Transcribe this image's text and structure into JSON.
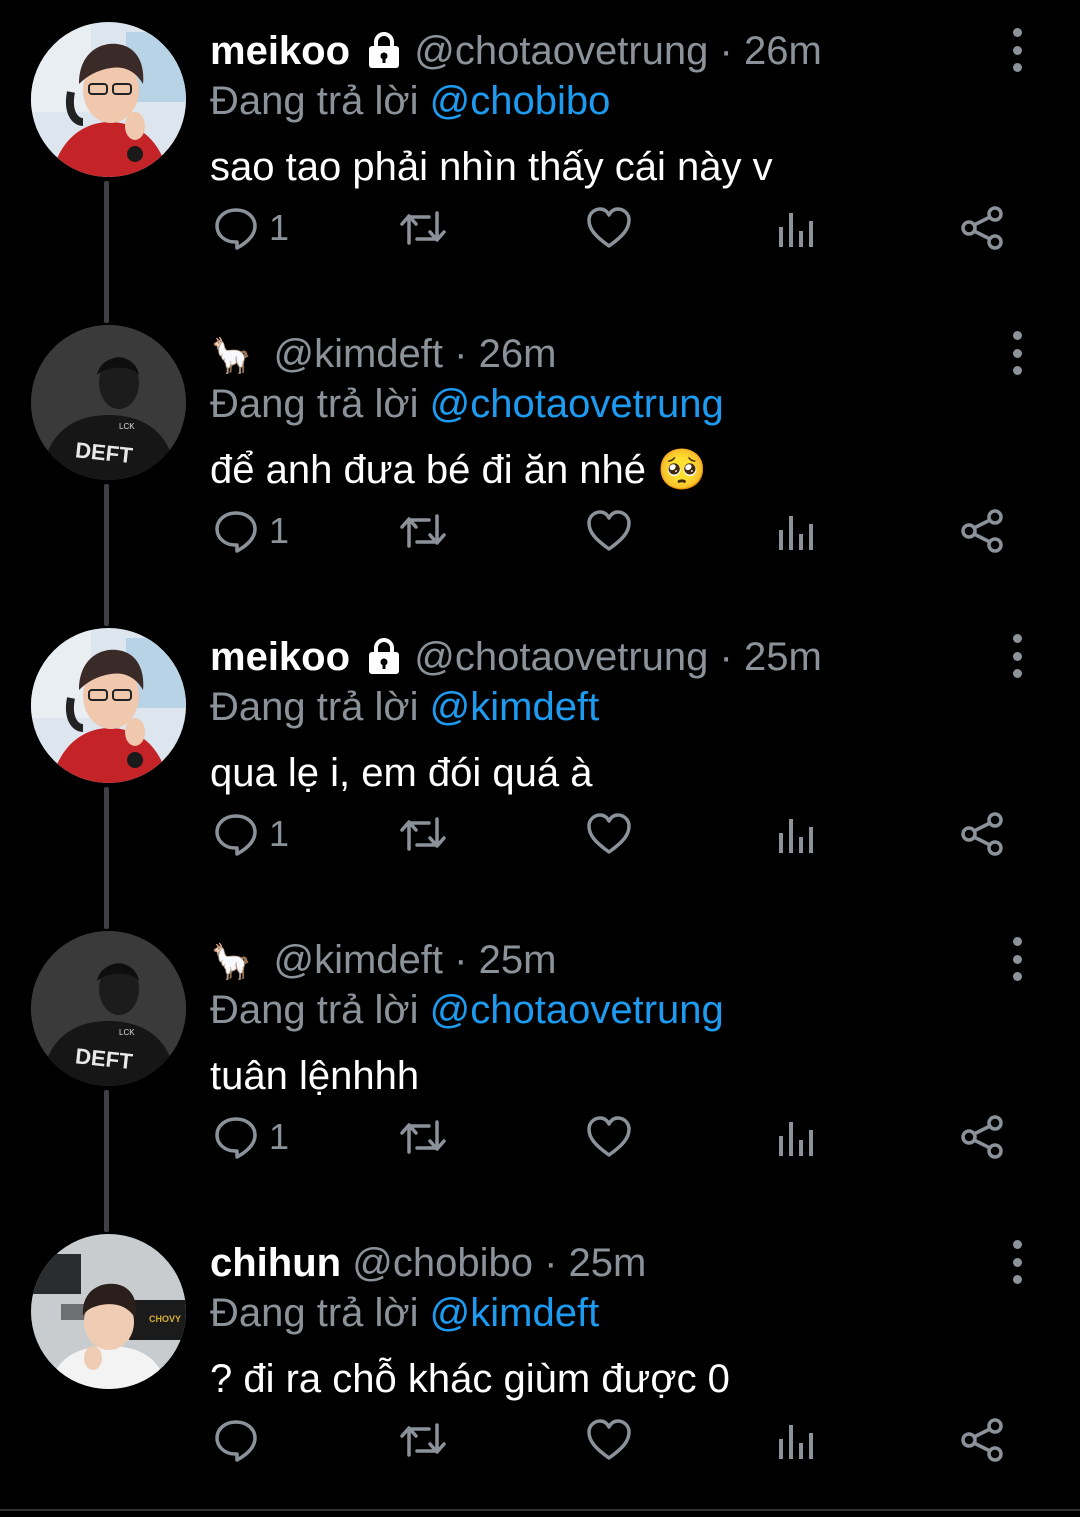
{
  "reply_prefix": "Đang trả lời",
  "tweets": [
    {
      "name": "meikoo",
      "handle": "@chotaovetrung",
      "sep": "·",
      "time": "26m",
      "reply_to": "@chobibo",
      "text": "sao tao phải nhìn thấy cái này v",
      "reply_count": "1"
    },
    {
      "emoji": "🦙",
      "handle": "@kimdeft",
      "sep": "·",
      "time": "26m",
      "reply_to": "@chotaovetrung",
      "text": "để anh đưa bé đi ăn nhé",
      "text_emoji": "🥺",
      "reply_count": "1",
      "avatar_text": "DEFT"
    },
    {
      "name": "meikoo",
      "handle": "@chotaovetrung",
      "sep": "·",
      "time": "25m",
      "reply_to": "@kimdeft",
      "text": "qua lẹ i, em đói quá à",
      "reply_count": "1"
    },
    {
      "emoji": "🦙",
      "handle": "@kimdeft",
      "sep": "·",
      "time": "25m",
      "reply_to": "@chotaovetrung",
      "text": "tuân lệnhhh",
      "reply_count": "1",
      "avatar_text": "DEFT"
    },
    {
      "name": "chihun",
      "handle": "@chobibo",
      "sep": "·",
      "time": "25m",
      "reply_to": "@kimdeft",
      "text": "? đi ra chỗ khác giùm được 0",
      "reply_count": "",
      "avatar_text": "CHOVY"
    }
  ],
  "colors": {
    "background": "#000000",
    "text": "#ffffff",
    "muted": "#8b9299",
    "link": "#1d9bf0",
    "thread_line": "#3d4145"
  },
  "icons": [
    "lock-icon",
    "more-icon",
    "reply-icon",
    "retweet-icon",
    "like-icon",
    "views-icon",
    "share-icon"
  ]
}
